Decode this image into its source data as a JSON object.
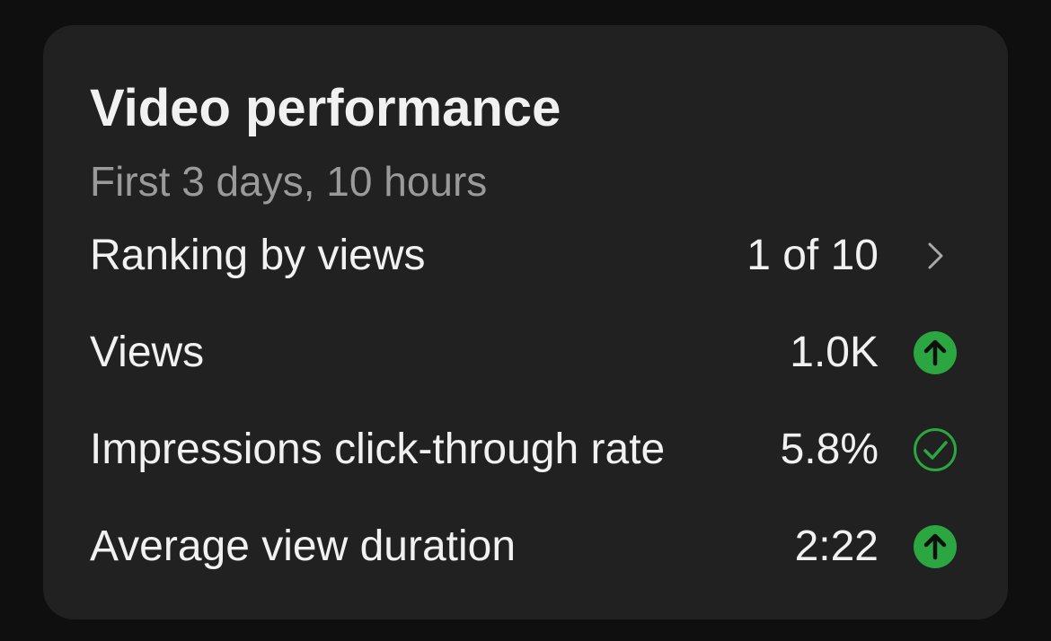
{
  "card": {
    "title": "Video performance",
    "subtitle": "First 3 days, 10 hours"
  },
  "rows": [
    {
      "label": "Ranking by views",
      "value": "1 of 10",
      "icon": "chevron-right-icon"
    },
    {
      "label": "Views",
      "value": "1.0K",
      "icon": "arrow-up-circle-icon"
    },
    {
      "label": "Impressions click-through rate",
      "value": "5.8%",
      "icon": "check-circle-icon"
    },
    {
      "label": "Average view duration",
      "value": "2:22",
      "icon": "arrow-up-circle-icon"
    }
  ],
  "colors": {
    "background": "#0f0f0f",
    "card": "#212121",
    "text_primary": "#f1f1f1",
    "text_secondary": "#9a9a9a",
    "positive_green": "#2ba640",
    "chevron": "#aaaaaa"
  }
}
